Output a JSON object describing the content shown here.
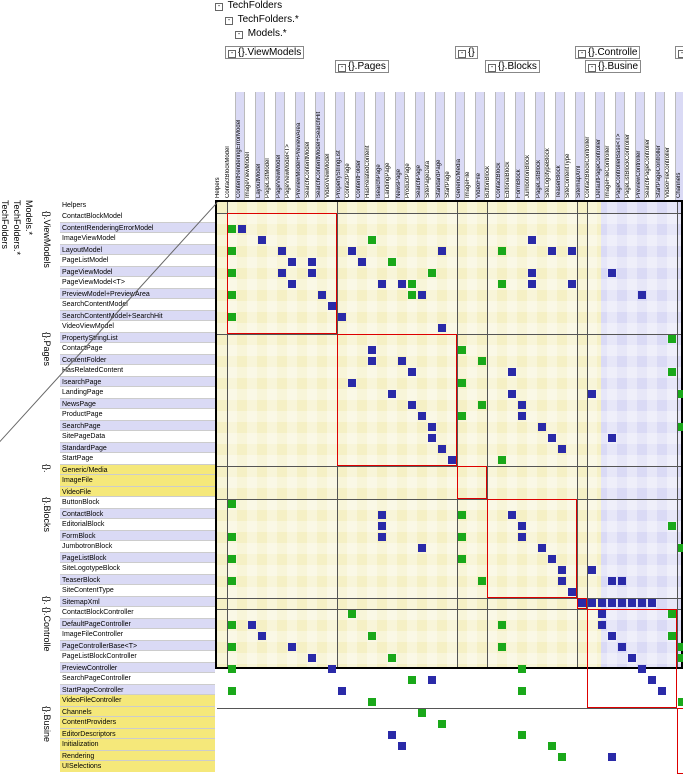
{
  "tree": {
    "root": "TechFolders",
    "l2": "TechFolders.*",
    "l3": "Models.*",
    "groups": [
      "{}.ViewModels",
      "{}.Pages",
      "{}",
      "{}.Blocks",
      "{}.Controlle",
      "{}.Busine"
    ]
  },
  "rowGroups": [
    {
      "name": "ViewModels",
      "rows": [
        "ContactBlockModel",
        "ContentRenderingErrorModel",
        "ImageViewModel",
        "LayoutModel",
        "PageListModel",
        "PageViewModel",
        "PageViewModel<T>",
        "PreviewModel+PreviewArea",
        "SearchContentModel",
        "SearchContentModel+SearchHit",
        "VideoViewModel"
      ]
    },
    {
      "name": "Pages",
      "rows": [
        "PropertyStringList",
        "ContactPage",
        "ContentFolder",
        "HasRelatedContent",
        "IsearchPage",
        "LandingPage",
        "NewsPage",
        "ProductPage",
        "SearchPage",
        "SitePageData",
        "StandardPage",
        "StartPage"
      ]
    },
    {
      "name": "",
      "rows": [
        "Generic/Media",
        "ImageFile",
        "VideoFile"
      ]
    },
    {
      "name": "Blocks",
      "rows": [
        "ButtonBlock",
        "ContactBlock",
        "EditorialBlock",
        "FormBlock",
        "JumbotronBlock",
        "PageListBlock",
        "SiteLogotypeBlock",
        "TeaserBlock",
        "SiteContentType"
      ]
    },
    {
      "name": "",
      "rows": [
        "SitemapXml"
      ]
    },
    {
      "name": "Controlle",
      "rows": [
        "ContactBlockController",
        "DefaultPageController",
        "ImageFileController",
        "PageControllerBase<T>",
        "PageListBlockController",
        "PreviewController",
        "SearchPageController",
        "StartPageController",
        "VideoFileController"
      ]
    },
    {
      "name": "Busine",
      "rows": [
        "Channels",
        "ContentProviders",
        "EditorDescriptors",
        "Initialization",
        "Rendering",
        "UISelections"
      ]
    }
  ],
  "helpers_label": "Helpers",
  "highlighted_rows": [
    23,
    24,
    25,
    44,
    45,
    46,
    47,
    48,
    49,
    50
  ],
  "groupBreaks": [
    0,
    11,
    23,
    26,
    35,
    36,
    45,
    51
  ],
  "cells": {
    "blue": [
      [
        1,
        1
      ],
      [
        2,
        3
      ],
      [
        3,
        5
      ],
      [
        4,
        6
      ],
      [
        4,
        8
      ],
      [
        5,
        5
      ],
      [
        5,
        8
      ],
      [
        6,
        6
      ],
      [
        7,
        9
      ],
      [
        8,
        10
      ],
      [
        9,
        11
      ],
      [
        3,
        12
      ],
      [
        4,
        13
      ],
      [
        6,
        15
      ],
      [
        6,
        17
      ],
      [
        7,
        19
      ],
      [
        3,
        21
      ],
      [
        10,
        21
      ],
      [
        2,
        30
      ],
      [
        5,
        30
      ],
      [
        6,
        30
      ],
      [
        3,
        32
      ],
      [
        3,
        34
      ],
      [
        6,
        34
      ],
      [
        5,
        38
      ],
      [
        7,
        41
      ],
      [
        12,
        14
      ],
      [
        13,
        14
      ],
      [
        13,
        17
      ],
      [
        14,
        18
      ],
      [
        15,
        12
      ],
      [
        16,
        16
      ],
      [
        17,
        18
      ],
      [
        18,
        19
      ],
      [
        19,
        20
      ],
      [
        20,
        20
      ],
      [
        21,
        21
      ],
      [
        22,
        22
      ],
      [
        14,
        28
      ],
      [
        16,
        28
      ],
      [
        17,
        29
      ],
      [
        18,
        29
      ],
      [
        19,
        31
      ],
      [
        20,
        32
      ],
      [
        21,
        33
      ],
      [
        16,
        36
      ],
      [
        20,
        38
      ],
      [
        27,
        28
      ],
      [
        28,
        29
      ],
      [
        29,
        29
      ],
      [
        30,
        31
      ],
      [
        31,
        32
      ],
      [
        32,
        33
      ],
      [
        33,
        33
      ],
      [
        34,
        34
      ],
      [
        27,
        15
      ],
      [
        28,
        15
      ],
      [
        29,
        15
      ],
      [
        30,
        19
      ],
      [
        32,
        36
      ],
      [
        33,
        38
      ],
      [
        33,
        39
      ],
      [
        35,
        35
      ],
      [
        35,
        36
      ],
      [
        35,
        37
      ],
      [
        35,
        38
      ],
      [
        35,
        39
      ],
      [
        35,
        40
      ],
      [
        35,
        41
      ],
      [
        35,
        42
      ],
      [
        37,
        2
      ],
      [
        38,
        3
      ],
      [
        39,
        6
      ],
      [
        40,
        8
      ],
      [
        41,
        10
      ],
      [
        42,
        20
      ],
      [
        43,
        11
      ],
      [
        36,
        37
      ],
      [
        37,
        37
      ],
      [
        38,
        38
      ],
      [
        39,
        39
      ],
      [
        40,
        40
      ],
      [
        41,
        41
      ],
      [
        42,
        42
      ],
      [
        43,
        43
      ],
      [
        47,
        16
      ],
      [
        48,
        17
      ],
      [
        49,
        38
      ]
    ],
    "green": [
      [
        1,
        0
      ],
      [
        3,
        0
      ],
      [
        5,
        0
      ],
      [
        7,
        0
      ],
      [
        9,
        0
      ],
      [
        2,
        14
      ],
      [
        4,
        16
      ],
      [
        6,
        18
      ],
      [
        7,
        18
      ],
      [
        5,
        20
      ],
      [
        3,
        27
      ],
      [
        6,
        27
      ],
      [
        0,
        47
      ],
      [
        1,
        47
      ],
      [
        3,
        47
      ],
      [
        5,
        47
      ],
      [
        12,
        23
      ],
      [
        15,
        23
      ],
      [
        18,
        23
      ],
      [
        13,
        25
      ],
      [
        17,
        25
      ],
      [
        22,
        27
      ],
      [
        11,
        44
      ],
      [
        14,
        44
      ],
      [
        16,
        45
      ],
      [
        19,
        45
      ],
      [
        21,
        46
      ],
      [
        13,
        47
      ],
      [
        15,
        48
      ],
      [
        18,
        48
      ],
      [
        20,
        49
      ],
      [
        26,
        0
      ],
      [
        29,
        0
      ],
      [
        31,
        0
      ],
      [
        33,
        0
      ],
      [
        27,
        23
      ],
      [
        29,
        23
      ],
      [
        31,
        23
      ],
      [
        33,
        25
      ],
      [
        28,
        44
      ],
      [
        30,
        45
      ],
      [
        32,
        46
      ],
      [
        33,
        47
      ],
      [
        34,
        48
      ],
      [
        37,
        0
      ],
      [
        39,
        0
      ],
      [
        41,
        0
      ],
      [
        43,
        0
      ],
      [
        36,
        12
      ],
      [
        38,
        14
      ],
      [
        40,
        16
      ],
      [
        42,
        18
      ],
      [
        37,
        27
      ],
      [
        39,
        27
      ],
      [
        41,
        29
      ],
      [
        43,
        29
      ],
      [
        36,
        44
      ],
      [
        38,
        44
      ],
      [
        39,
        45
      ],
      [
        40,
        45
      ],
      [
        41,
        46
      ],
      [
        42,
        47
      ],
      [
        43,
        48
      ],
      [
        44,
        14
      ],
      [
        45,
        19
      ],
      [
        46,
        21
      ],
      [
        47,
        29
      ],
      [
        48,
        32
      ],
      [
        49,
        33
      ],
      [
        44,
        45
      ],
      [
        45,
        46
      ],
      [
        46,
        47
      ],
      [
        47,
        48
      ],
      [
        48,
        49
      ],
      [
        49,
        50
      ]
    ]
  }
}
